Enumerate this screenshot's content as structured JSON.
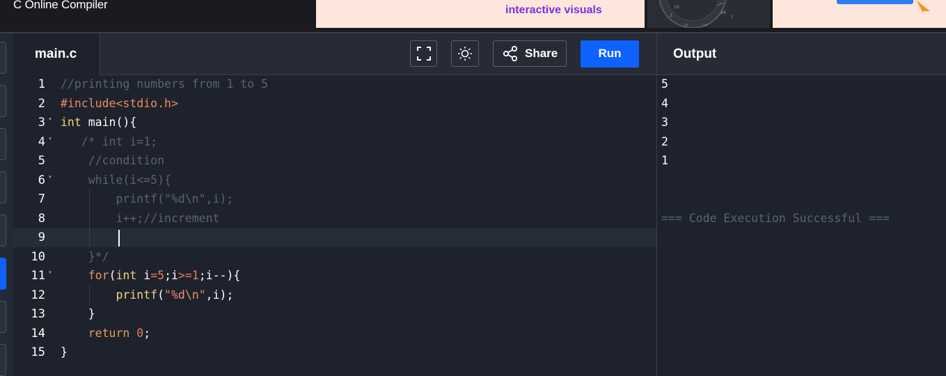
{
  "site": {
    "title": "C Online Compiler"
  },
  "ads": {
    "banner_text": "interactive visuals"
  },
  "editor": {
    "file_tab": "main.c",
    "share_label": "Share",
    "run_label": "Run",
    "lines": [
      {
        "n": "1",
        "tokens": [
          {
            "t": "//printing numbers from 1 to 5",
            "c": "com"
          }
        ]
      },
      {
        "n": "2",
        "tokens": [
          {
            "t": "#include<stdio.h>",
            "c": "pre"
          }
        ]
      },
      {
        "n": "3",
        "fold": true,
        "tokens": [
          {
            "t": "int",
            "c": "type"
          },
          {
            "t": " main(){",
            "c": "plain"
          }
        ]
      },
      {
        "n": "4",
        "fold": true,
        "tokens": [
          {
            "t": "   /* int i=1;",
            "c": "com"
          }
        ]
      },
      {
        "n": "5",
        "tokens": [
          {
            "t": "    //condition",
            "c": "com"
          }
        ]
      },
      {
        "n": "6",
        "fold": true,
        "tokens": [
          {
            "t": "    while(i<=5){",
            "c": "com"
          }
        ]
      },
      {
        "n": "7",
        "tokens": [
          {
            "t": "        printf(\"%d\\n\",i);",
            "c": "com"
          }
        ]
      },
      {
        "n": "8",
        "tokens": [
          {
            "t": "        i++;//increment",
            "c": "com"
          }
        ]
      },
      {
        "n": "9",
        "active": true,
        "tokens": [
          {
            "t": "",
            "c": "plain"
          }
        ]
      },
      {
        "n": "10",
        "tokens": [
          {
            "t": "    }*/",
            "c": "com"
          }
        ]
      },
      {
        "n": "11",
        "fold": true,
        "tokens": [
          {
            "t": "    ",
            "c": "plain"
          },
          {
            "t": "for",
            "c": "kw"
          },
          {
            "t": "(",
            "c": "plain"
          },
          {
            "t": "int",
            "c": "type"
          },
          {
            "t": " i",
            "c": "plain"
          },
          {
            "t": "=5",
            "c": "num"
          },
          {
            "t": ";i",
            "c": "plain"
          },
          {
            "t": ">=1",
            "c": "num"
          },
          {
            "t": ";i--){",
            "c": "plain"
          }
        ]
      },
      {
        "n": "12",
        "tokens": [
          {
            "t": "        ",
            "c": "plain"
          },
          {
            "t": "printf",
            "c": "fn"
          },
          {
            "t": "(",
            "c": "plain"
          },
          {
            "t": "\"%d\\n\"",
            "c": "str"
          },
          {
            "t": ",i);",
            "c": "plain"
          }
        ]
      },
      {
        "n": "13",
        "tokens": [
          {
            "t": "    }",
            "c": "plain"
          }
        ]
      },
      {
        "n": "14",
        "tokens": [
          {
            "t": "    ",
            "c": "plain"
          },
          {
            "t": "return",
            "c": "kw"
          },
          {
            "t": " ",
            "c": "plain"
          },
          {
            "t": "0",
            "c": "num"
          },
          {
            "t": ";",
            "c": "plain"
          }
        ]
      },
      {
        "n": "15",
        "tokens": [
          {
            "t": "}",
            "c": "plain"
          }
        ]
      }
    ]
  },
  "output": {
    "title": "Output",
    "lines": [
      "5",
      "4",
      "3",
      "2",
      "1"
    ],
    "status": "=== Code Execution Successful ==="
  },
  "colors": {
    "accent": "#0f62fe",
    "background": "#1d222c"
  }
}
